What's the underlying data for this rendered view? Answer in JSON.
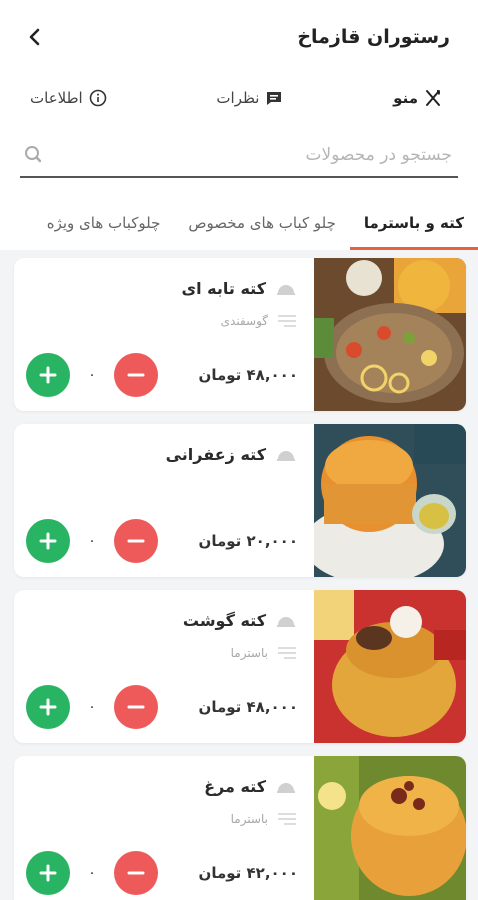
{
  "header": {
    "title": "رستوران قازماخ"
  },
  "top_tabs": [
    {
      "label": "منو",
      "icon": "cutlery-icon",
      "active": true
    },
    {
      "label": "نظرات",
      "icon": "comment-icon",
      "active": false
    },
    {
      "label": "اطلاعات",
      "icon": "info-icon",
      "active": false
    }
  ],
  "search": {
    "placeholder": "جستجو در محصولات"
  },
  "categories": [
    {
      "label": "کته و باسترما",
      "active": true
    },
    {
      "label": "چلو کباب های مخصوص",
      "active": false
    },
    {
      "label": "چلوکباب های ویژه",
      "active": false
    }
  ],
  "products": [
    {
      "name": "کته تابه ای",
      "subtitle": "گوسفندی",
      "price": "۴۸,۰۰۰ تومان",
      "quantity": "۰"
    },
    {
      "name": "کته زعفرانی",
      "subtitle": "",
      "price": "۲۰,۰۰۰ تومان",
      "quantity": "۰"
    },
    {
      "name": "کته گوشت",
      "subtitle": "باسترما",
      "price": "۴۸,۰۰۰ تومان",
      "quantity": "۰"
    },
    {
      "name": "کته مرغ",
      "subtitle": "باسترما",
      "price": "۴۲,۰۰۰ تومان",
      "quantity": "۰"
    }
  ],
  "colors": {
    "accent": "#e8603c",
    "plus": "#28b463",
    "minus": "#ee5a5a"
  }
}
